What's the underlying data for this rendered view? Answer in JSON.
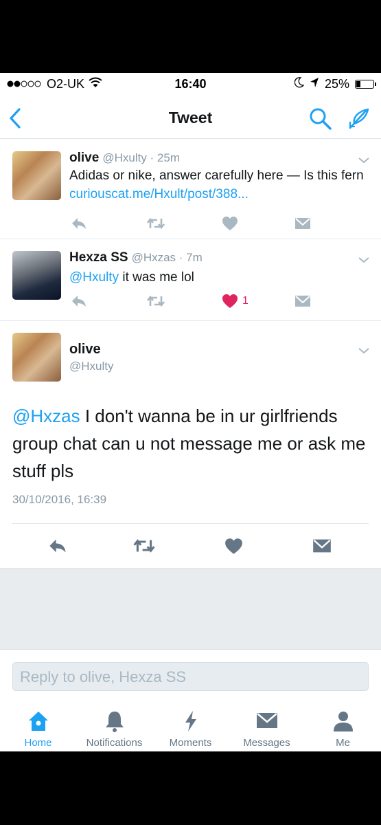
{
  "status_bar": {
    "carrier": "O2-UK",
    "time": "16:40",
    "battery": "25%",
    "battery_level": 0.25
  },
  "nav": {
    "title": "Tweet"
  },
  "tweets": [
    {
      "name": "olive",
      "handle_time": "@Hxulty · 25m",
      "text": "Adidas or nike, answer carefully here — Is this fern ",
      "link": "curiouscat.me/Hxult/post/388..."
    },
    {
      "name": "Hexza SS",
      "handle_time": "@Hxzas · 7m",
      "mention": "@Hxulty",
      "text": " it was me lol",
      "like_count": "1"
    }
  ],
  "main_tweet": {
    "name": "olive",
    "handle": "@Hxulty",
    "mention": "@Hxzas",
    "text": " I don't wanna be in ur girlfriends group chat can u not message me or ask me stuff pls",
    "timestamp": "30/10/2016, 16:39"
  },
  "reply": {
    "placeholder": "Reply to olive, Hexza SS"
  },
  "tabs": [
    {
      "label": "Home",
      "icon": "home-icon",
      "active": true
    },
    {
      "label": "Notifications",
      "icon": "bell-icon",
      "active": false
    },
    {
      "label": "Moments",
      "icon": "lightning-icon",
      "active": false
    },
    {
      "label": "Messages",
      "icon": "envelope-icon",
      "active": false
    },
    {
      "label": "Me",
      "icon": "person-icon",
      "active": false
    }
  ],
  "colors": {
    "accent": "#1da1f2",
    "like": "#e0245e",
    "muted": "#8899a6",
    "icon_gray": "#aab8c2"
  }
}
